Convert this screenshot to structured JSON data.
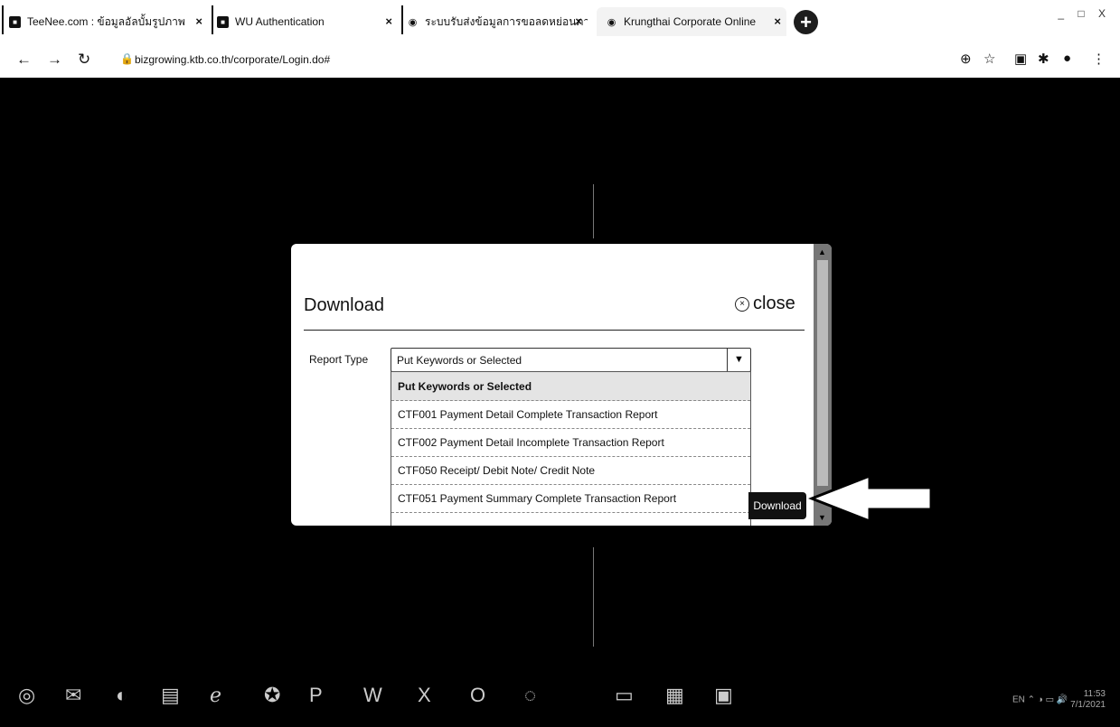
{
  "browser": {
    "tabs": [
      {
        "title": "TeeNee.com : ข้อมูลอัลบั้มรูปภาพ"
      },
      {
        "title": "WU Authentication"
      },
      {
        "title": "ระบบรับส่งข้อมูลการขอลดหย่อนภาษี"
      },
      {
        "title": "Krungthai Corporate Online"
      }
    ],
    "new_tab_symbol": "+",
    "window_controls": "_ □ X",
    "url": "bizgrowing.ktb.co.th/corporate/Login.do#"
  },
  "modal": {
    "title": "Download",
    "close_label": "close",
    "report_type_label": "Report Type",
    "select_value": "Put Keywords or Selected",
    "options": [
      "Put Keywords or Selected",
      "CTF001 Payment Detail Complete Transaction Report",
      "CTF002 Payment Detail Incomplete Transaction Report",
      "CTF050 Receipt/ Debit Note/ Credit Note",
      "CTF051 Payment Summary Complete Transaction Report"
    ],
    "download_label": "Download"
  },
  "taskbar": {
    "tray_lang": "EN",
    "tray_time": "11:53",
    "tray_date": "7/1/2021"
  },
  "colors": {
    "page_background": "#000000",
    "modal_background": "#ffffff",
    "download_button": "#111111"
  }
}
